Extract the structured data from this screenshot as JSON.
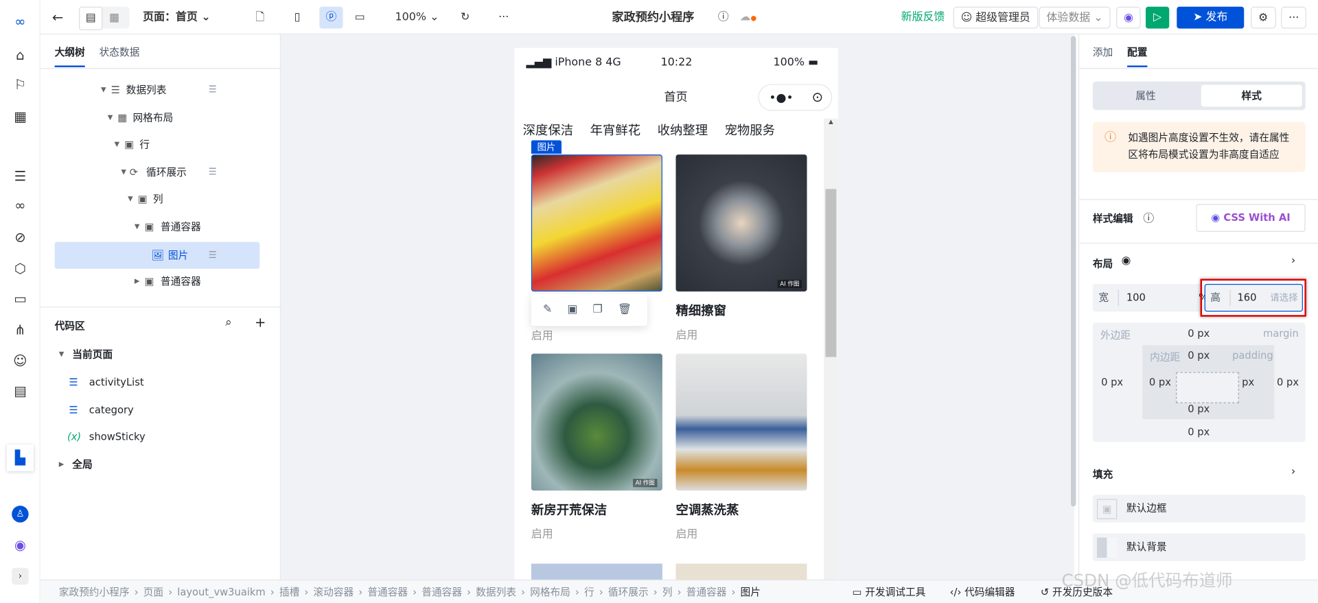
{
  "app": {
    "title": "家政预约小程序",
    "page_selector": "页面：首页",
    "zoom": "100%",
    "feedback": "新版反馈",
    "user": "超级管理员",
    "data_mode": "体验数据",
    "publish": "发布"
  },
  "colors": {
    "accent": "#0052d9",
    "run": "#00a870",
    "feedback": "#00a870",
    "warning_bg": "#fff3e8",
    "highlight_border": "#e00000"
  },
  "left": {
    "tabs": [
      "大纲树",
      "状态数据"
    ],
    "tree": [
      {
        "label": "数据列表",
        "icon": "list-icon"
      },
      {
        "label": "网格布局",
        "icon": "grid-icon"
      },
      {
        "label": "行",
        "icon": "container-icon"
      },
      {
        "label": "循环展示",
        "icon": "loop-icon"
      },
      {
        "label": "列",
        "icon": "container-icon"
      },
      {
        "label": "普通容器",
        "icon": "container-icon"
      },
      {
        "label": "图片",
        "icon": "image-icon"
      },
      {
        "label": "普通容器",
        "icon": "container-icon"
      }
    ],
    "code_title": "代码区",
    "current_page": "当前页面",
    "code_items": [
      "activityList",
      "category",
      "showSticky"
    ],
    "global": "全局"
  },
  "phone": {
    "carrier": "iPhone 8  4G",
    "time": "10:22",
    "battery": "100%",
    "nav_title": "首页",
    "categories": [
      "深度保洁",
      "年宵鲜花",
      "收纳整理",
      "宠物服务"
    ],
    "selected_tag": "图片",
    "cards": [
      {
        "title": "",
        "status": "启用"
      },
      {
        "title": "精细擦窗",
        "status": "启用"
      },
      {
        "title": "新房开荒保洁",
        "status": "启用"
      },
      {
        "title": "空调蒸洗蒸",
        "status": "启用"
      }
    ],
    "ai_badge": "AI 作图"
  },
  "right": {
    "tabs": [
      "添加",
      "配置"
    ],
    "seg": [
      "属性",
      "样式"
    ],
    "warning": "如遇图片高度设置不生效，请在属性区将布局模式设置为非高度自适应",
    "style_edit": "样式编辑",
    "css_ai": "CSS With AI",
    "layout": "布局",
    "width_label": "宽",
    "width_value": "100",
    "width_unit": "%",
    "height_label": "高",
    "height_value": "160",
    "height_placeholder": "请选择",
    "margin_label": "外边距",
    "margin_en": "margin",
    "padding_label": "内边距",
    "padding_en": "padding",
    "zero": "0 px",
    "fill": "填充",
    "border": "默认边框",
    "background": "默认背景"
  },
  "breadcrumb": [
    "家政预约小程序",
    "页面",
    "layout_vw3uaikm",
    "插槽",
    "滚动容器",
    "普通容器",
    "普通容器",
    "数据列表",
    "网格布局",
    "行",
    "循环展示",
    "列",
    "普通容器",
    "图片"
  ],
  "bottom_tools": [
    "开发调试工具",
    "代码编辑器",
    "开发历史版本"
  ],
  "watermark": "CSDN @低代码布道师"
}
